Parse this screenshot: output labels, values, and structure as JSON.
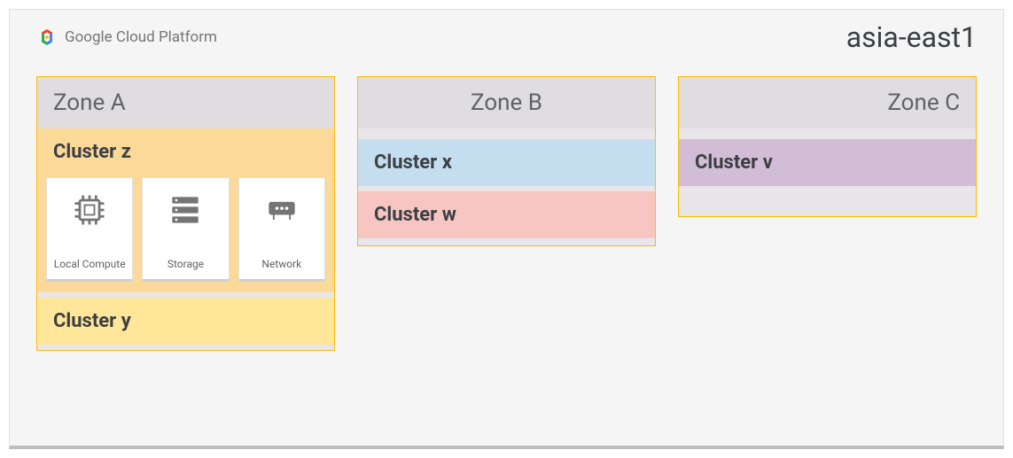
{
  "platform": {
    "name": "Google Cloud Platform"
  },
  "region": {
    "name": "asia-east1"
  },
  "zones": {
    "a": {
      "label": "Zone A",
      "clusters": {
        "z": {
          "label": "Cluster z"
        },
        "y": {
          "label": "Cluster y"
        }
      },
      "resources": {
        "compute": {
          "label": "Local Compute"
        },
        "storage": {
          "label": "Storage"
        },
        "network": {
          "label": "Network"
        }
      }
    },
    "b": {
      "label": "Zone B",
      "clusters": {
        "x": {
          "label": "Cluster x"
        },
        "w": {
          "label": "Cluster w"
        }
      }
    },
    "c": {
      "label": "Zone C",
      "clusters": {
        "v": {
          "label": "Cluster v"
        }
      }
    }
  }
}
